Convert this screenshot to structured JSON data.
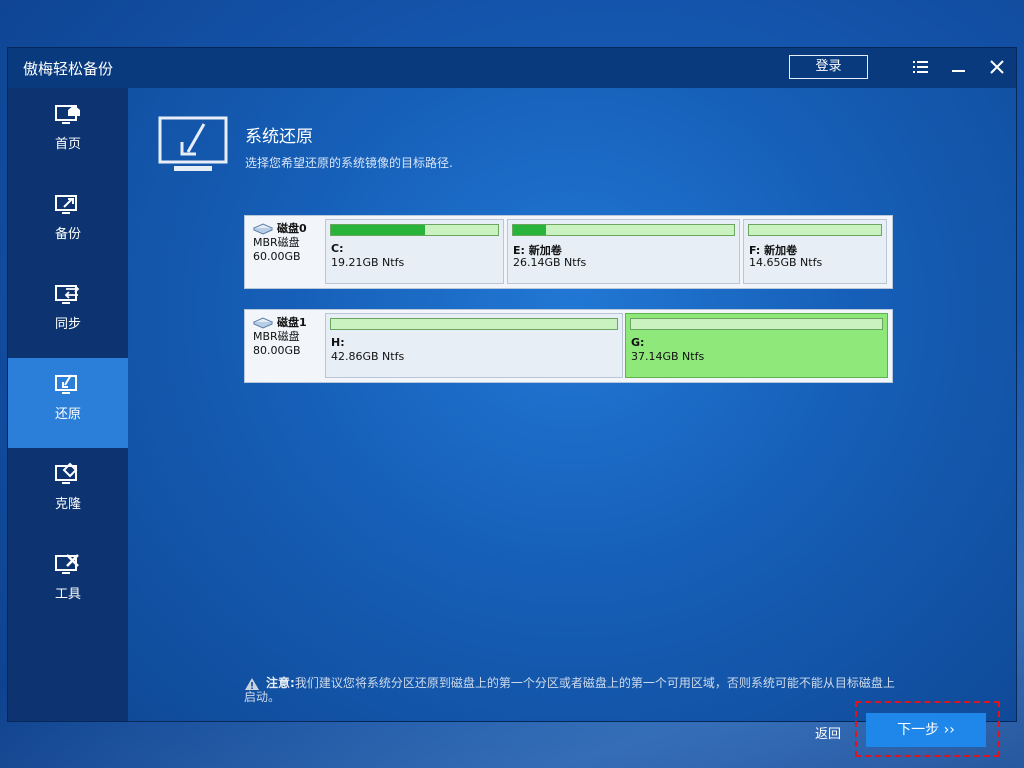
{
  "app": {
    "title": "傲梅轻松备份",
    "login_label": "登录"
  },
  "titlebar_icons": [
    "menu-icon",
    "minimize-icon",
    "close-icon"
  ],
  "sidebar": {
    "items": [
      {
        "label": "首页",
        "icon": "home-icon",
        "active": false
      },
      {
        "label": "备份",
        "icon": "backup-icon",
        "active": false
      },
      {
        "label": "同步",
        "icon": "sync-icon",
        "active": false
      },
      {
        "label": "还原",
        "icon": "restore-icon",
        "active": true
      },
      {
        "label": "克隆",
        "icon": "clone-icon",
        "active": false
      },
      {
        "label": "工具",
        "icon": "tools-icon",
        "active": false
      }
    ]
  },
  "header": {
    "title": "系统还原",
    "subtitle": "选择您希望还原的系统镜像的目标路径."
  },
  "disks": [
    {
      "name": "磁盘0",
      "type": "MBR磁盘",
      "size": "60.00GB",
      "partitions": [
        {
          "label": "C:",
          "size": "19.21GB Ntfs",
          "used": 0.56,
          "selected": false
        },
        {
          "label": "E: 新加卷",
          "size": "26.14GB Ntfs",
          "used": 0.15,
          "selected": false
        },
        {
          "label": "F: 新加卷",
          "size": "14.65GB Ntfs",
          "used": 0.0,
          "selected": false
        }
      ]
    },
    {
      "name": "磁盘1",
      "type": "MBR磁盘",
      "size": "80.00GB",
      "partitions": [
        {
          "label": "H:",
          "size": "42.86GB Ntfs",
          "used": 0.0,
          "selected": false
        },
        {
          "label": "G:",
          "size": "37.14GB Ntfs",
          "used": 0.0,
          "selected": true
        }
      ]
    }
  ],
  "note": {
    "prefix": "注意:",
    "text": "我们建议您将系统分区还原到磁盘上的第一个分区或者磁盘上的第一个可用区域，否则系统可能不能从目标磁盘上启动。"
  },
  "footer": {
    "back_label": "返回",
    "next_label": "下一步 ››"
  },
  "colors": {
    "accent": "#1f86ea",
    "sidebar_active": "#2c7fd8",
    "selected_partition": "#8ee87a",
    "used_bar": "#28b43a",
    "highlight": "#e0141e"
  }
}
